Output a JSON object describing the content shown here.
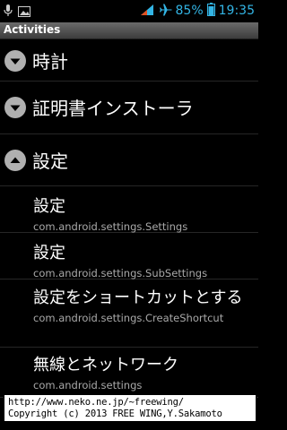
{
  "status_bar": {
    "battery_percent": "85%",
    "time": "19:35",
    "left_icons": [
      "mic-icon",
      "image-icon"
    ],
    "right_icons": [
      "signal-icon",
      "airplane-icon",
      "battery-icon"
    ]
  },
  "title_bar": {
    "title": "Activities"
  },
  "list": {
    "groups": [
      {
        "label": "時計",
        "expanded": false
      },
      {
        "label": "証明書インストーラ",
        "expanded": false
      },
      {
        "label": "設定",
        "expanded": true
      }
    ],
    "children": [
      {
        "title": "設定",
        "subtitle": "com.android.settings.Settings"
      },
      {
        "title": "設定",
        "subtitle": "com.android.settings.SubSettings"
      },
      {
        "title": "設定をショートカットとする",
        "subtitle": "com.android.settings.CreateShortcut"
      },
      {
        "title": "無線とネットワーク",
        "subtitle": "com.android.settings"
      }
    ]
  },
  "credit": {
    "line1": "http://www.neko.ne.jp/~freewing/",
    "line2": "Copyright (c) 2013 FREE WING,Y.Sakamoto"
  },
  "colors": {
    "accent": "#33b5e5",
    "background": "#000000",
    "divider": "#262626"
  }
}
